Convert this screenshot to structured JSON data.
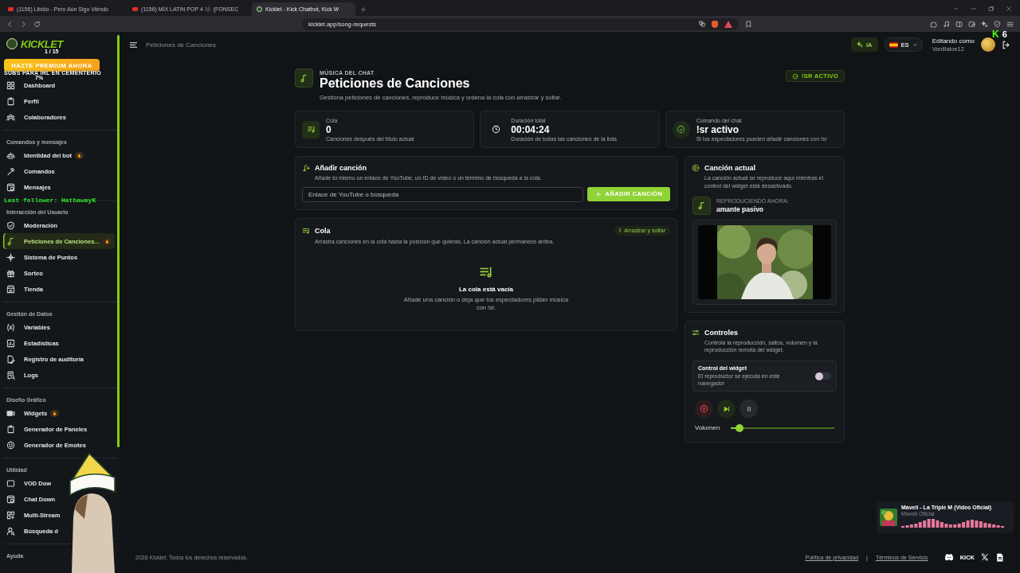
{
  "browser": {
    "tabs": [
      {
        "title": "(1156) Libido - Pero Aún Sigo Viéndo",
        "selected": false
      },
      {
        "title": "(1156) MIX LATIN POP 4 🎼 (FONSEC",
        "selected": false
      },
      {
        "title": "Kicklet - Kick Chatbot, Kick W",
        "selected": true
      }
    ],
    "url": "kicklet.app/song-requests"
  },
  "stream_overlays": {
    "kick_mark": "K",
    "counter": "6",
    "banner": "SUBS PARA IRL EN CEMENTERIO",
    "follower": "Last follower: HathawayK"
  },
  "sidebar": {
    "logo": "KICKLET",
    "logo_counter": "1 / 15",
    "premium_button": "HAZTE PREMIUM AHORA",
    "sections": [
      {
        "items": [
          {
            "label": "Dashboard",
            "selected": false,
            "hot": false,
            "corner_note": "7%"
          },
          {
            "label": "Perfil",
            "selected": false,
            "hot": false
          },
          {
            "label": "Colaboradores",
            "selected": false,
            "hot": false
          }
        ]
      },
      {
        "title": "Comandos y mensajes",
        "items": [
          {
            "label": "Identidad del bot",
            "selected": false,
            "hot": true
          },
          {
            "label": "Comandos",
            "selected": false,
            "hot": false
          },
          {
            "label": "Mensajes",
            "selected": false,
            "hot": false
          }
        ]
      },
      {
        "title": "Interacción del Usuario",
        "items": [
          {
            "label": "Moderación",
            "selected": false,
            "hot": false
          },
          {
            "label": "Peticiones de Canciones...",
            "selected": true,
            "hot": true
          },
          {
            "label": "Sistema de Puntos",
            "selected": false,
            "hot": false
          },
          {
            "label": "Sorteo",
            "selected": false,
            "hot": false
          },
          {
            "label": "Tienda",
            "selected": false,
            "hot": false
          }
        ]
      },
      {
        "title": "Gestión de Datos",
        "items": [
          {
            "label": "Variables",
            "selected": false,
            "hot": false
          },
          {
            "label": "Estadísticas",
            "selected": false,
            "hot": false
          },
          {
            "label": "Registro de auditoría",
            "selected": false,
            "hot": false
          },
          {
            "label": "Logs",
            "selected": false,
            "hot": false
          }
        ]
      },
      {
        "title": "Diseño Gráfico",
        "items": [
          {
            "label": "Widgets",
            "selected": false,
            "hot": true
          },
          {
            "label": "Generador de Paneles",
            "selected": false,
            "hot": false
          },
          {
            "label": "Generador de Emotes",
            "selected": false,
            "hot": false
          }
        ]
      },
      {
        "title": "Utilidad",
        "items": [
          {
            "label": "VOD Dow",
            "selected": false,
            "hot": false
          },
          {
            "label": "Chat Down",
            "selected": false,
            "hot": false
          },
          {
            "label": "Multi-Stream",
            "selected": false,
            "hot": false
          },
          {
            "label": "Búsqueda d",
            "selected": false,
            "hot": false
          }
        ]
      },
      {
        "title": "Ayuda"
      }
    ]
  },
  "topbar": {
    "breadcrumb": "Peticiones de Canciones",
    "ai_button": "IA",
    "language": "ES",
    "editing_label": "Editando como",
    "username": "Vanillaloe12"
  },
  "header": {
    "eyebrow": "MÚSICA DEL CHAT",
    "title": "Peticiones de Canciones",
    "subtitle": "Gestiona peticiones de canciones, reproduce música y ordena la cola con arrastrar y soltar.",
    "status_badge": "!SR ACTIVO"
  },
  "stats": [
    {
      "label": "Cola",
      "value": "0",
      "caption": "Canciones después del título actual"
    },
    {
      "label": "Duración total",
      "value": "00:04:24",
      "caption": "Duración de todas las canciones de la lista"
    },
    {
      "label": "Comando del chat",
      "value": "!sr activo",
      "caption": "Si los espectadores pueden añadir canciones con !sr"
    }
  ],
  "add_song": {
    "title": "Añadir canción",
    "description": "Añade tú mismo un enlace de YouTube, un ID de vídeo o un término de búsqueda a la cola.",
    "placeholder": "Enlace de YouTube o búsqueda",
    "button": "AÑADIR CANCIÓN"
  },
  "queue": {
    "title": "Cola",
    "description": "Arrastra canciones en la cola hasta la posición que quieras. La canción actual permanece arriba.",
    "drag_badge": "Arrastrar y soltar",
    "empty_title": "La cola está vacía",
    "empty_text": "Añade una canción o deja que los espectadores pidan música con !sr."
  },
  "now_playing": {
    "title": "Canción actual",
    "description": "La canción actual se reproduce aquí mientras el control del widget está desactivado.",
    "playing_label": "REPRODUCIENDO AHORA:",
    "song": "amante pasivo"
  },
  "controls": {
    "title": "Controles",
    "description": "Controla la reproducción, saltos, volumen y la reproducción remota del widget.",
    "widget_control": {
      "title": "Control del widget",
      "text": "El reproductor se ejecuta en este navegador",
      "on": false
    },
    "volume_label": "Volumen",
    "volume": {
      "level": 0.08
    }
  },
  "music_widget": {
    "title": "Maveli - La Triple M (Video Oficial)",
    "artist": "Maveli Oficial"
  },
  "footer": {
    "copyright": "2026 Kicklet. Todos los derechos reservados.",
    "links": [
      "Política de privacidad",
      "Términos de Servicio"
    ],
    "separator": "|",
    "kick_logo": "KICK"
  }
}
